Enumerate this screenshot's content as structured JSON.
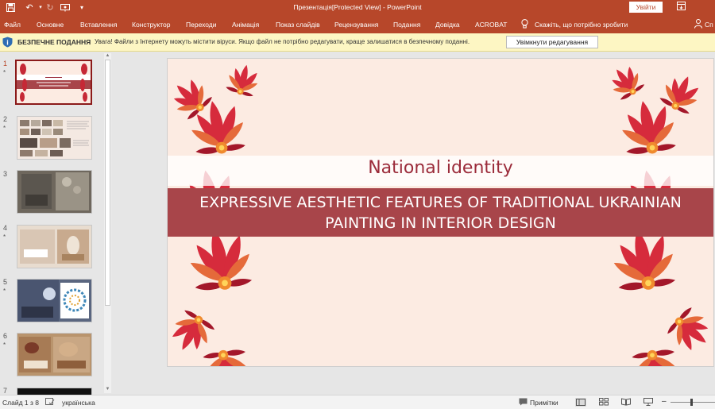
{
  "window": {
    "title": "Презентація[Protected View]  -  PowerPoint",
    "sign_in": "Увійти"
  },
  "ribbon": {
    "tabs": [
      "Файл",
      "Основне",
      "Вставлення",
      "Конструктор",
      "Переходи",
      "Анімація",
      "Показ слайдів",
      "Рецензування",
      "Подання",
      "Довідка",
      "ACROBAT"
    ],
    "tell_me": "Скажіть, що потрібно зробити",
    "share": "Сп"
  },
  "protected_view": {
    "title": "БЕЗПЕЧНЕ ПОДАННЯ",
    "message": "Увага! Файли з Інтернету можуть містити віруси. Якщо файл не потрібно редагувати, краще залишатися в безпечному поданні.",
    "enable_button": "Увімкнути редагування"
  },
  "thumbnails": [
    {
      "number": "1",
      "star": "*",
      "selected": true
    },
    {
      "number": "2",
      "star": "*"
    },
    {
      "number": "3",
      "star": ""
    },
    {
      "number": "4",
      "star": "*"
    },
    {
      "number": "5",
      "star": "*"
    },
    {
      "number": "6",
      "star": "*"
    },
    {
      "number": "7",
      "star": ""
    }
  ],
  "slide": {
    "title": "National identity",
    "subtitle": "EXPRESSIVE AESTHETIC FEATURES OF TRADITIONAL UKRAINIAN PAINTING IN INTERIOR DESIGN"
  },
  "status": {
    "slide_counter": "Слайд 1 з 8",
    "language": "українська",
    "notes": "Примітки"
  },
  "colors": {
    "ribbon": "#b7472a",
    "protected_bar": "#fdf6c3",
    "slide_background": "#fcebe2",
    "subtitle_band": "#a8454a",
    "title_text": "#9b2b3a"
  }
}
